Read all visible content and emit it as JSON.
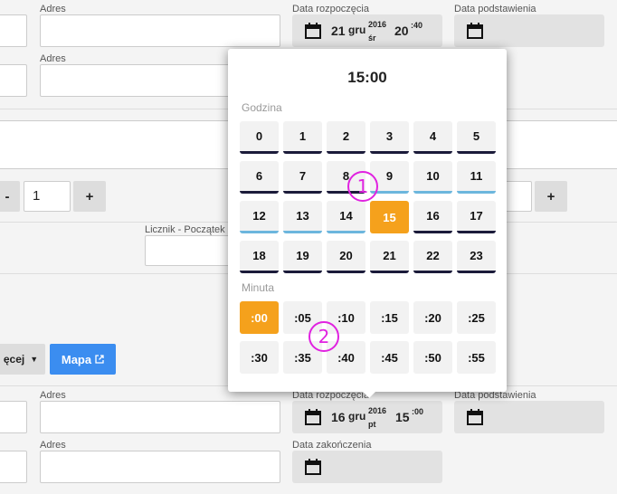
{
  "form_top": {
    "address_label_1": "Adres",
    "address_label_2": "Adres",
    "start_date_label": "Data rozpoczęcia",
    "start_date": {
      "day": "21",
      "month": "gru",
      "year": "2016",
      "weekday": "śr",
      "hour": "20",
      "minute": ":40"
    },
    "substitution_date_label": "Data podstawienia",
    "stepper_value": "1",
    "stepper_minus": "-",
    "stepper_plus": "+",
    "stepper2_plus": "+",
    "counter_label": "Licznik - Początek",
    "more_button": "ęcej",
    "map_button": "Mapa"
  },
  "form_bottom": {
    "address_label_1": "Adres",
    "address_label_2": "Adres",
    "start_date_label": "Data rozpoczęcia",
    "start_date": {
      "day": "16",
      "month": "gru",
      "year": "2016",
      "weekday": "pt",
      "hour": "15",
      "minute": ":00"
    },
    "substitution_date_label": "Data podstawienia",
    "end_date_label": "Data zakończenia"
  },
  "time_picker": {
    "title": "15:00",
    "hour_section_label": "Godzina",
    "minute_section_label": "Minuta",
    "hours": [
      "0",
      "1",
      "2",
      "3",
      "4",
      "5",
      "6",
      "7",
      "8",
      "9",
      "10",
      "11",
      "12",
      "13",
      "14",
      "15",
      "16",
      "17",
      "18",
      "19",
      "20",
      "21",
      "22",
      "23"
    ],
    "selected_hour": "15",
    "minutes": [
      ":00",
      ":05",
      ":10",
      ":15",
      ":20",
      ":25",
      ":30",
      ":35",
      ":40",
      ":45",
      ":50",
      ":55"
    ],
    "selected_minute": ":00"
  },
  "annotations": [
    "1",
    "2"
  ],
  "colors": {
    "accent": "#f5a11c",
    "button_blue": "#3b8df0",
    "marker": "#e022e0"
  }
}
